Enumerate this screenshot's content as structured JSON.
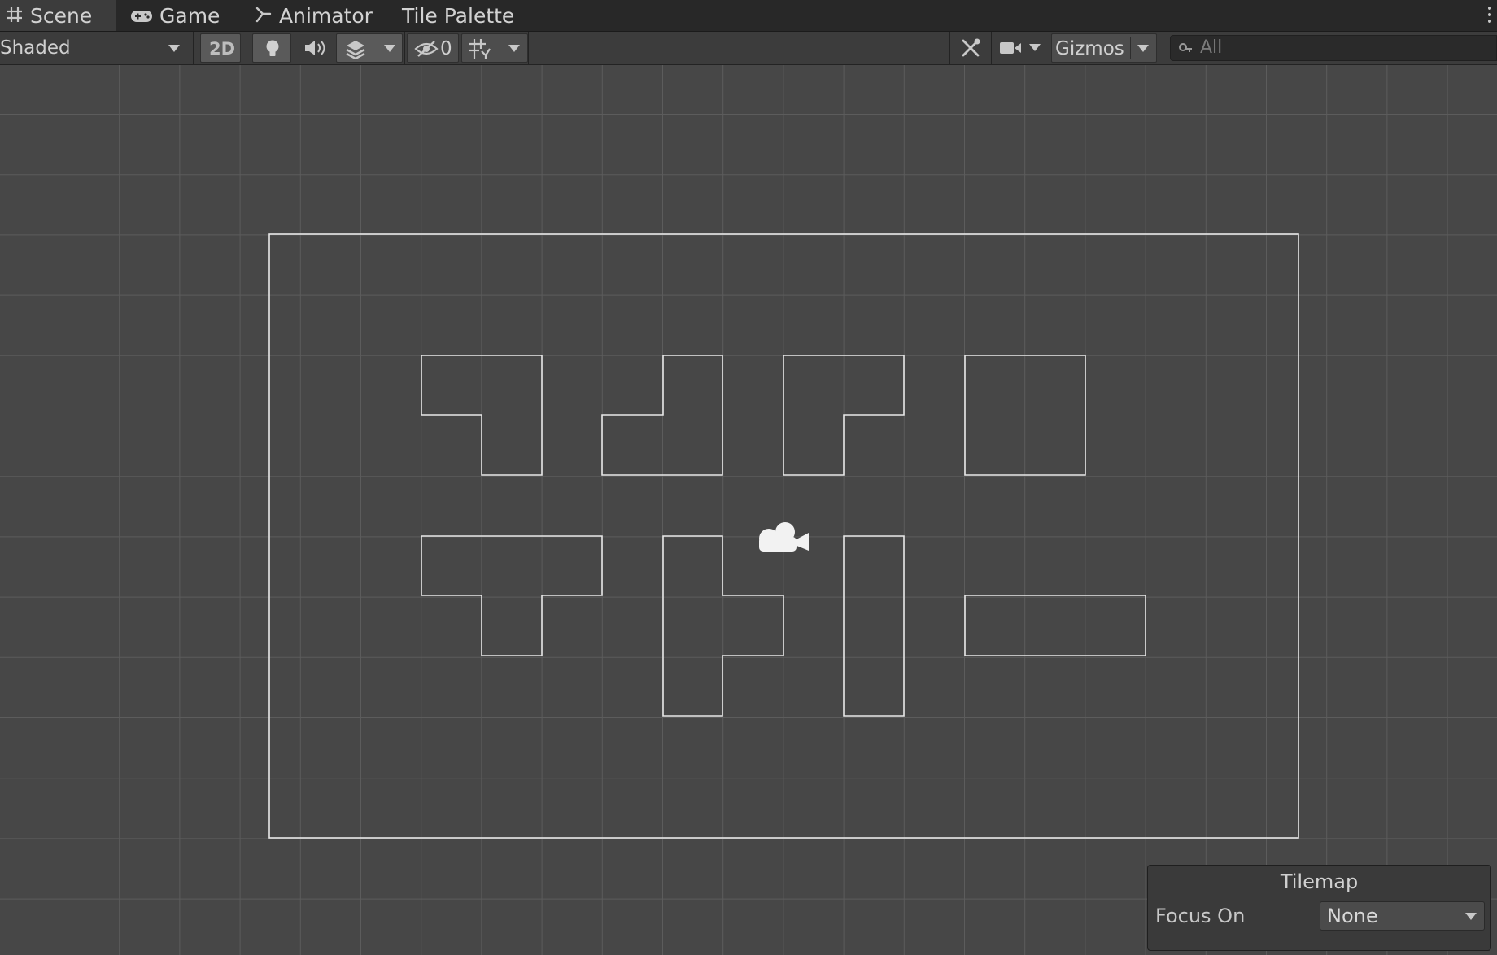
{
  "tabs": [
    {
      "label": "Scene",
      "icon": "grid-hash-icon",
      "active": true
    },
    {
      "label": "Game",
      "icon": "gamepad-icon",
      "active": false
    },
    {
      "label": "Animator",
      "icon": "animator-icon",
      "active": false
    },
    {
      "label": "Tile Palette",
      "icon": "",
      "active": false
    }
  ],
  "toolbar": {
    "shading_mode": "Shaded",
    "mode_2d_label": "2D",
    "hidden_count": "0",
    "gizmos_label": "Gizmos",
    "search_placeholder": "All",
    "icons": [
      "lighting-bulb-icon",
      "audio-icon",
      "effects-layers-icon",
      "scene-visibility-icon",
      "grid-snap-icon",
      "tools-icon",
      "camera-icon",
      "search-icon"
    ]
  },
  "scene": {
    "center_icon": "camera-gizmo-icon",
    "colors": {
      "background": "#474747",
      "grid": "#5c5c5c",
      "outline": "#e6e6e6"
    }
  },
  "tilemap_overlay": {
    "title": "Tilemap",
    "focus_label": "Focus On",
    "focus_value": "None"
  }
}
